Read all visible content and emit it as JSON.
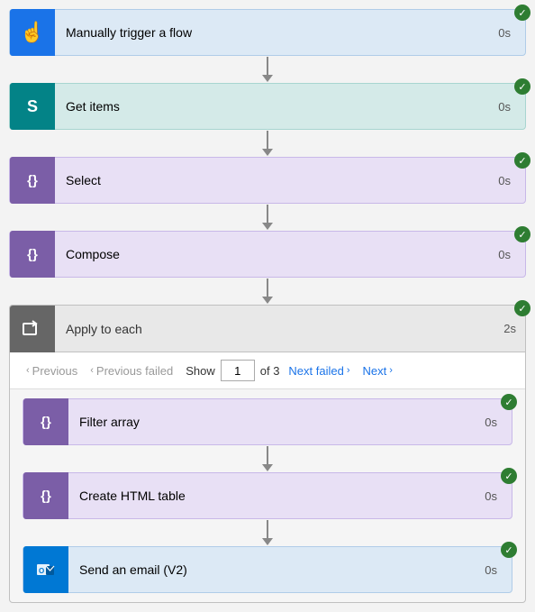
{
  "steps": [
    {
      "id": "trigger",
      "label": "Manually trigger a flow",
      "duration": "0s",
      "type": "trigger",
      "iconSymbol": "✋",
      "checked": true
    },
    {
      "id": "getitems",
      "label": "Get items",
      "duration": "0s",
      "type": "sharepoint",
      "iconSymbol": "S",
      "checked": true
    },
    {
      "id": "select",
      "label": "Select",
      "duration": "0s",
      "type": "purple",
      "iconSymbol": "{}",
      "checked": true
    },
    {
      "id": "compose",
      "label": "Compose",
      "duration": "0s",
      "type": "purple",
      "iconSymbol": "{}",
      "checked": true
    }
  ],
  "applyToEach": {
    "label": "Apply to each",
    "duration": "2s",
    "checked": true,
    "pagination": {
      "previousLabel": "Previous",
      "previousFailedLabel": "Previous failed",
      "showLabel": "Show",
      "currentPage": "1",
      "ofLabel": "of 3",
      "nextFailedLabel": "Next failed",
      "nextLabel": "Next"
    },
    "innerSteps": [
      {
        "id": "filterarray",
        "label": "Filter array",
        "duration": "0s",
        "type": "purple",
        "iconSymbol": "{}",
        "checked": true
      },
      {
        "id": "createhtmltable",
        "label": "Create HTML table",
        "duration": "0s",
        "type": "purple",
        "iconSymbol": "{}",
        "checked": true
      },
      {
        "id": "sendemail",
        "label": "Send an email (V2)",
        "duration": "0s",
        "type": "outlook",
        "iconSymbol": "✉",
        "checked": true
      }
    ]
  },
  "checkmark": "✓",
  "arrowDown": "↓",
  "colors": {
    "trigger_bg": "#dce9f5",
    "trigger_icon": "#1a73e8",
    "sharepoint_bg": "#d4eae8",
    "sharepoint_icon": "#038387",
    "purple_bg": "#e8e0f5",
    "purple_icon": "#7b5ea7",
    "outlook_bg": "#dce9f5",
    "outlook_icon": "#0078d4",
    "green_check": "#2e7d32",
    "apply_header": "#e8e8e8",
    "apply_icon": "#666666"
  }
}
